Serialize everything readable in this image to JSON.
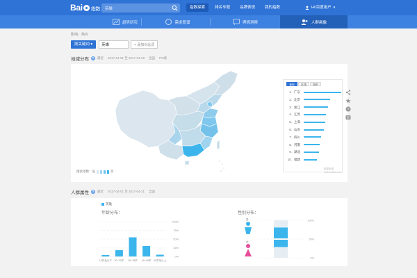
{
  "header": {
    "logo_text": "Bai",
    "logo_sub": "指数",
    "search_value": "英雄",
    "nav": [
      {
        "label": "指数探索",
        "active": true
      },
      {
        "label": "排名专题",
        "active": false
      },
      {
        "label": "品牌表现",
        "active": false
      },
      {
        "label": "我的指数",
        "active": false
      }
    ],
    "user_name": "Hi!百度用户"
  },
  "subnav": {
    "tabs": [
      {
        "label": "趋势研究",
        "active": false
      },
      {
        "label": "需求图谱",
        "active": false
      },
      {
        "label": "舆情洞察",
        "active": false
      },
      {
        "label": "人群画像",
        "active": true
      }
    ]
  },
  "breadcrumb": "影响：热片",
  "keyword": {
    "button_label": "按关键词 ▾",
    "input_value": "英雄",
    "add_compare_label": "+ 添加对比词"
  },
  "region_section": {
    "title": "地域分布",
    "range": [
      "最近",
      "2017-04-01 至 2017-04-28",
      "全国",
      "PC端"
    ],
    "legend_low": "搜索指数：低",
    "legend_high": "高",
    "rank_tabs": [
      {
        "label": "省份",
        "active": true
      },
      {
        "label": "区域",
        "active": false
      },
      {
        "label": "城市",
        "active": false
      }
    ],
    "ranking": [
      {
        "rank": "1.",
        "name": "广东",
        "value": 100
      },
      {
        "rank": "2.",
        "name": "北京",
        "value": 71
      },
      {
        "rank": "3.",
        "name": "浙江",
        "value": 64
      },
      {
        "rank": "4.",
        "name": "江苏",
        "value": 60
      },
      {
        "rank": "5.",
        "name": "上海",
        "value": 57
      },
      {
        "rank": "6.",
        "name": "山东",
        "value": 53
      },
      {
        "rank": "7.",
        "name": "四川",
        "value": 47
      },
      {
        "rank": "8.",
        "name": "河南",
        "value": 43
      },
      {
        "rank": "9.",
        "name": "湖北",
        "value": 40
      },
      {
        "rank": "10.",
        "name": "福建",
        "value": 36
      }
    ],
    "footer_note": "数据来源 index.baidu.com",
    "colors": {
      "highlight": "#3bb5ec",
      "mid": "#9fd3ee",
      "light": "#c8dde9",
      "base": "#dbe6ee"
    }
  },
  "crowd_section": {
    "title": "人群属性",
    "range": [
      "最近",
      "2017-04-01 至 2017-04-31",
      "全国"
    ],
    "series_legend": "英雄",
    "age_title": "年龄分布：",
    "gender_title": "性别分布：",
    "chart_data": [
      {
        "type": "bar",
        "categories": [
          "19岁及以下",
          "20~29岁",
          "30~39岁",
          "40~49岁",
          "50岁及以上"
        ],
        "values": [
          4,
          18,
          55,
          30,
          5
        ],
        "yticks": [
          "100%",
          "75%",
          "50%",
          "25%",
          "0%"
        ],
        "ylim": [
          0,
          100
        ]
      },
      {
        "type": "bar",
        "categories": [
          "男",
          "女"
        ],
        "values": [
          60,
          40
        ],
        "yticks": [
          "100%",
          "50%",
          "0%"
        ],
        "ylim": [
          0,
          100
        ]
      }
    ]
  }
}
